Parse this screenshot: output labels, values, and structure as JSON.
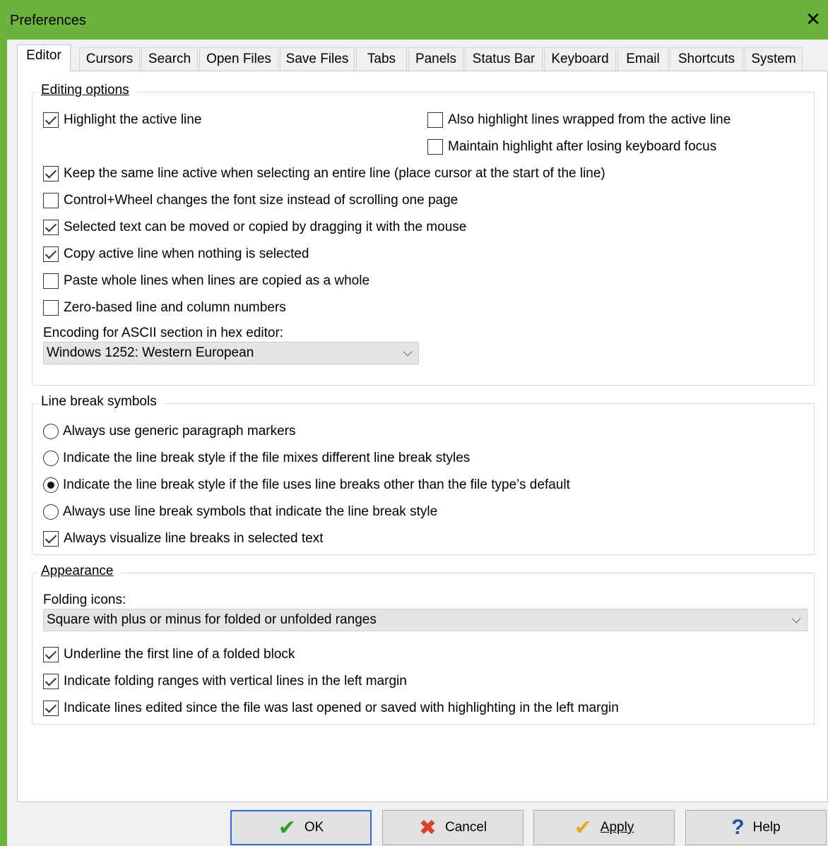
{
  "window": {
    "title": "Preferences"
  },
  "tabs": [
    "Editor",
    "Cursors",
    "Search",
    "Open Files",
    "Save Files",
    "Tabs",
    "Panels",
    "Status Bar",
    "Keyboard",
    "Email",
    "Shortcuts",
    "System"
  ],
  "editing": {
    "title": "Editing options",
    "highlight_active": "Highlight the active line",
    "also_highlight": "Also highlight lines wrapped from the active line",
    "maintain_highlight": "Maintain highlight after losing keyboard focus",
    "keep_same_line": "Keep the same line active when selecting an entire line (place cursor at the start of the line)",
    "control_wheel": "Control+Wheel changes the font size instead of scrolling one page",
    "drag_text": "Selected text can be moved or copied by dragging it with the mouse",
    "copy_active": "Copy active line when nothing is selected",
    "paste_whole": "Paste whole lines when lines are copied as a whole",
    "zero_based": "Zero-based line and column numbers",
    "encoding_label": "Encoding for ASCII section in hex editor:",
    "encoding_value": "Windows 1252: Western European"
  },
  "linebreak": {
    "title": "Line break symbols",
    "opt1": "Always use generic paragraph markers",
    "opt2": "Indicate the line break style if the file mixes different line break styles",
    "opt3": "Indicate the line break style if the file uses line breaks other than the file type’s default",
    "opt4": "Always use line break symbols that indicate the line break style",
    "visualize": "Always visualize line breaks in selected text"
  },
  "appearance": {
    "title": "Appearance",
    "folding_label": "Folding icons:",
    "folding_value": "Square with plus or minus for folded or unfolded ranges",
    "underline_first": "Underline the first line of a folded block",
    "indicate_folding": "Indicate folding ranges with vertical lines in the left margin",
    "indicate_edited": "Indicate lines edited since the file was last opened or saved with highlighting in the left margin"
  },
  "buttons": {
    "ok": "OK",
    "cancel": "Cancel",
    "apply": "Apply",
    "help": "Help"
  },
  "colors": {
    "titlebar": "#6cb33e",
    "ok_icon": "#2e9e2e",
    "cancel_icon": "#d9412b",
    "apply_icon": "#e8a820",
    "help_icon": "#1f4fa8"
  }
}
